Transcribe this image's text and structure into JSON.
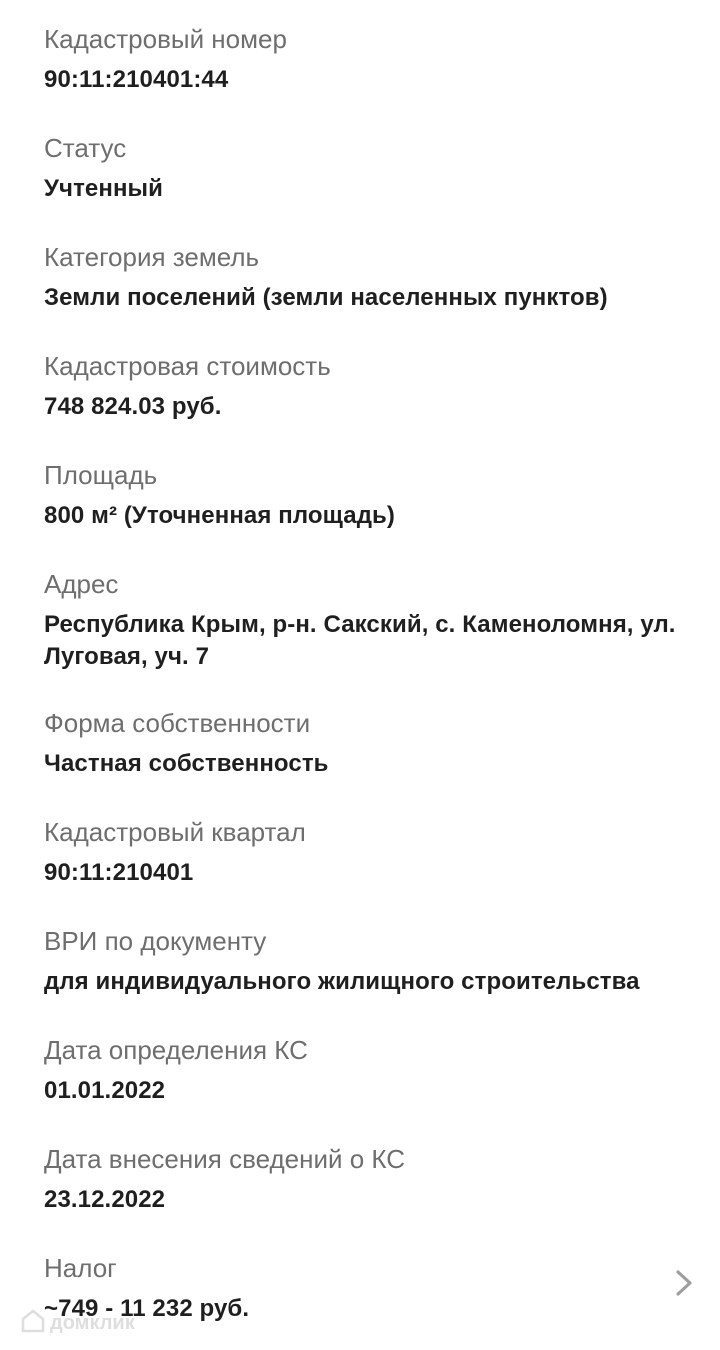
{
  "fields": [
    {
      "label": "Кадастровый номер",
      "value": "90:11:210401:44"
    },
    {
      "label": "Статус",
      "value": "Учтенный"
    },
    {
      "label": "Категория земель",
      "value": "Земли поселений (земли населенных пунктов)"
    },
    {
      "label": "Кадастровая стоимость",
      "value": "748 824.03 руб."
    },
    {
      "label": "Площадь",
      "value": "800 м² (Уточненная площадь)"
    },
    {
      "label": "Адрес",
      "value": "Республика Крым, р-н. Сакский, с. Каменоломня, ул. Луговая, уч. 7"
    },
    {
      "label": "Форма собственности",
      "value": "Частная собственность"
    },
    {
      "label": "Кадастровый квартал",
      "value": "90:11:210401"
    },
    {
      "label": "ВРИ по документу",
      "value": "для индивидуального жилищного строительства"
    },
    {
      "label": "Дата определения КС",
      "value": "01.01.2022"
    },
    {
      "label": "Дата внесения сведений о КС",
      "value": "23.12.2022"
    },
    {
      "label": "Налог",
      "value": "~749 - 11 232 руб."
    }
  ],
  "watermark": {
    "text": "домклик",
    "icon": "domclick-logo-icon"
  },
  "icons": {
    "tax_chevron": "chevron-right-icon"
  },
  "colors": {
    "label": "#6e6e6e",
    "value": "#1f1f1f",
    "chevron": "#9e9e9e",
    "background": "#ffffff"
  }
}
